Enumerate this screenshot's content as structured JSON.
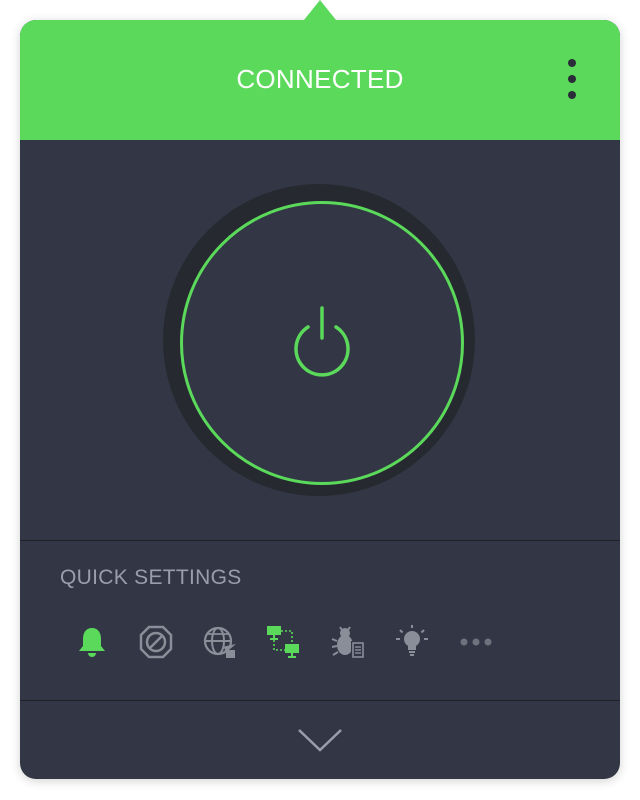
{
  "header": {
    "status": "CONNECTED",
    "menu_icon": "more-vertical-icon"
  },
  "power": {
    "icon": "power-icon",
    "state": "connected"
  },
  "quick_settings": {
    "title": "QUICK SETTINGS",
    "items": [
      {
        "icon": "bell-icon",
        "active": true
      },
      {
        "icon": "block-icon",
        "active": false
      },
      {
        "icon": "globe-arrow-icon",
        "active": false
      },
      {
        "icon": "network-icon",
        "active": true
      },
      {
        "icon": "bug-log-icon",
        "active": false
      },
      {
        "icon": "lightbulb-icon",
        "active": false
      },
      {
        "icon": "more-horizontal-icon",
        "active": false
      }
    ]
  },
  "footer": {
    "expand_icon": "chevron-down-icon"
  },
  "colors": {
    "accent": "#5bd95a",
    "panel": "#333745",
    "ring": "#262930",
    "muted": "#8a8e99"
  }
}
